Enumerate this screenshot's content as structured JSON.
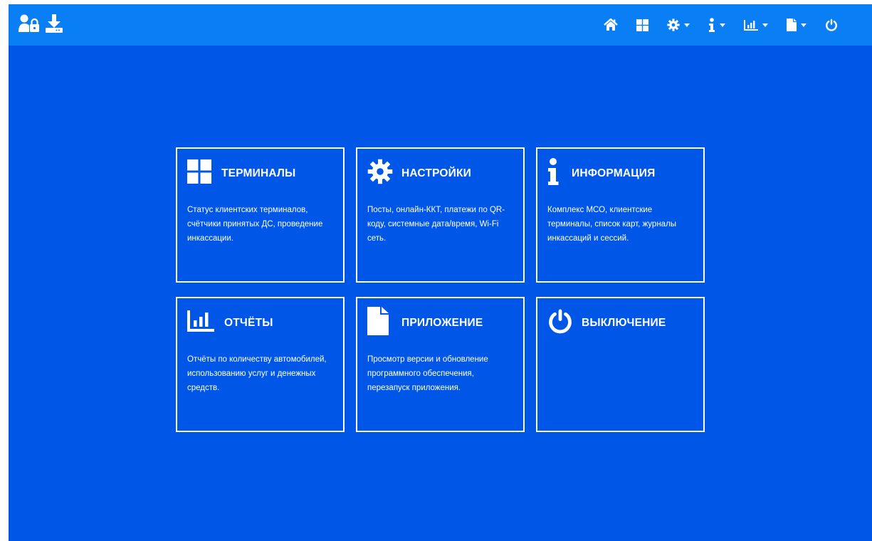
{
  "colors": {
    "background": "#0057e7",
    "topbar": "#0a7ff5",
    "foreground": "#ffffff"
  },
  "topbar": {
    "left_icons": [
      "user-lock-icon",
      "download-icon"
    ],
    "right_icons": [
      {
        "name": "home-icon",
        "has_caret": false
      },
      {
        "name": "grid-icon",
        "has_caret": false
      },
      {
        "name": "gear-icon",
        "has_caret": true
      },
      {
        "name": "info-icon",
        "has_caret": true
      },
      {
        "name": "chart-icon",
        "has_caret": true
      },
      {
        "name": "file-icon",
        "has_caret": true
      },
      {
        "name": "power-icon",
        "has_caret": false
      }
    ]
  },
  "tiles": [
    {
      "icon": "grid-icon",
      "title": "ТЕРМИНАЛЫ",
      "description": "Статус клиентских терминалов, счётчики принятых ДС, проведение инкассации."
    },
    {
      "icon": "gear-icon",
      "title": "НАСТРОЙКИ",
      "description": "Посты, онлайн-ККТ, платежи по QR-коду, системные дата/время, Wi-Fi сеть."
    },
    {
      "icon": "info-icon",
      "title": "ИНФОРМАЦИЯ",
      "description": "Комплекс МСО, клиентские терминалы, список карт, журналы инкассаций и сессий."
    },
    {
      "icon": "chart-icon",
      "title": "ОТЧЁТЫ",
      "description": "Отчёты по количеству автомобилей, использованию услуг и денежных средств."
    },
    {
      "icon": "file-icon",
      "title": "ПРИЛОЖЕНИЕ",
      "description": "Просмотр версии и обновление программного обеспечения, перезапуск приложения."
    },
    {
      "icon": "power-icon",
      "title": "ВЫКЛЮЧЕНИЕ",
      "description": ""
    }
  ]
}
